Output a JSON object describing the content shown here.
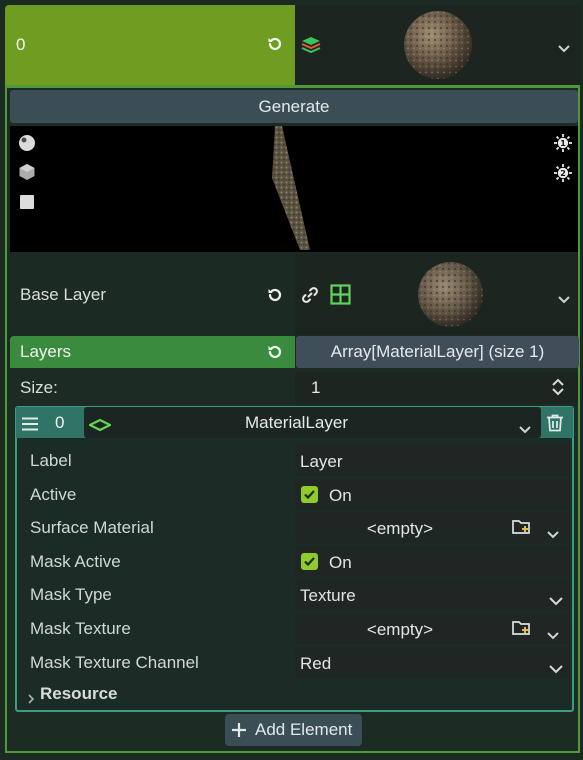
{
  "top": {
    "index": "0",
    "sphere_icon": "rock-sphere-thumbnail",
    "stack_icon": "layered-material-icon"
  },
  "generate_label": "Generate",
  "preview": {
    "light_buttons": [
      "1",
      "2"
    ],
    "left_icons": [
      "sphere-preview-icon",
      "box-preview-icon",
      "quad-preview-icon"
    ]
  },
  "base_layer": {
    "label": "Base Layer"
  },
  "layers": {
    "label": "Layers",
    "value": "Array[MaterialLayer] (size 1)"
  },
  "size": {
    "label": "Size:",
    "value": "1"
  },
  "element": {
    "index": "0",
    "type_label": "MaterialLayer",
    "properties": {
      "label": {
        "name": "Label",
        "value": "Layer"
      },
      "active": {
        "name": "Active",
        "value": "On"
      },
      "surface_material": {
        "name": "Surface Material",
        "value": "<empty>"
      },
      "mask_active": {
        "name": "Mask Active",
        "value": "On"
      },
      "mask_type": {
        "name": "Mask Type",
        "value": "Texture"
      },
      "mask_texture": {
        "name": "Mask Texture",
        "value": "<empty>"
      },
      "mask_texture_channel": {
        "name": "Mask Texture Channel",
        "value": "Red"
      }
    },
    "resource_label": "Resource"
  },
  "add_element_label": "Add Element",
  "colors": {
    "accent_green": "#6f9d22",
    "layers_green": "#3a8b3d",
    "element_teal": "#2f7466",
    "check_green": "#8fcb2c"
  }
}
